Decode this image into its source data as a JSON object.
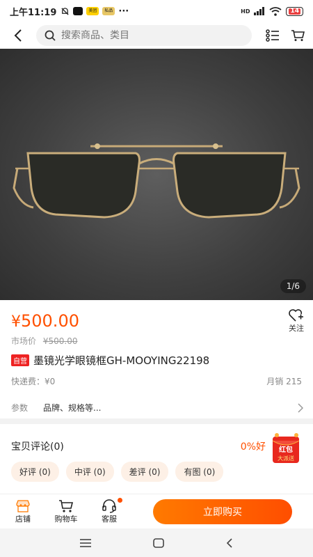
{
  "status_bar": {
    "time": "上午11:19",
    "app_badge_1": "美团",
    "app_badge_2": "私品",
    "more": "···",
    "network": "HD",
    "battery": "14"
  },
  "search": {
    "placeholder": "搜索商品、类目"
  },
  "gallery": {
    "indicator": "1/6"
  },
  "product": {
    "price_symbol": "¥",
    "price": "500.00",
    "market_label": "市场价",
    "market_price": "¥500.00",
    "follow_label": "关注",
    "tag": "自营",
    "title": "墨镜光学眼镜框GH-MOOYING22198",
    "shipping": "快递费：¥0",
    "monthly_sales": "月销  215",
    "params_label": "参数",
    "params_value": "品牌、规格等..."
  },
  "reviews": {
    "title": "宝贝评论(0)",
    "good_rate": "0%好",
    "red_envelope_line1": "红包",
    "red_envelope_line2": "大派送",
    "chips": [
      "好评 (0)",
      "中评 (0)",
      "差评 (0)",
      "有图 (0)"
    ]
  },
  "bottom_bar": {
    "store_label": "店铺",
    "cart_label": "购物车",
    "service_label": "客服",
    "buy_label": "立即购买"
  },
  "colors": {
    "accent": "#ff5000",
    "tag_red": "#ee2222"
  }
}
